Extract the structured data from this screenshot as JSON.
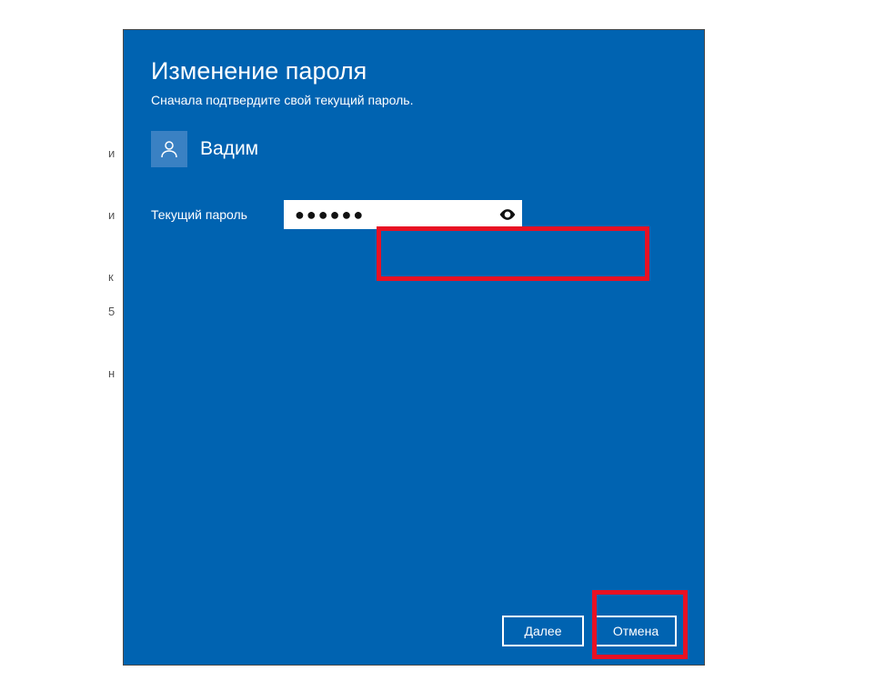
{
  "dialog": {
    "title": "Изменение пароля",
    "subtitle": "Сначала подтвердите свой текущий пароль."
  },
  "user": {
    "name": "Вадим"
  },
  "field": {
    "label": "Текущий пароль",
    "value": "●●●●●●"
  },
  "buttons": {
    "next": "Далее",
    "cancel": "Отмена"
  },
  "background_hints": [
    "и",
    "и",
    "к",
    "5",
    "н"
  ]
}
